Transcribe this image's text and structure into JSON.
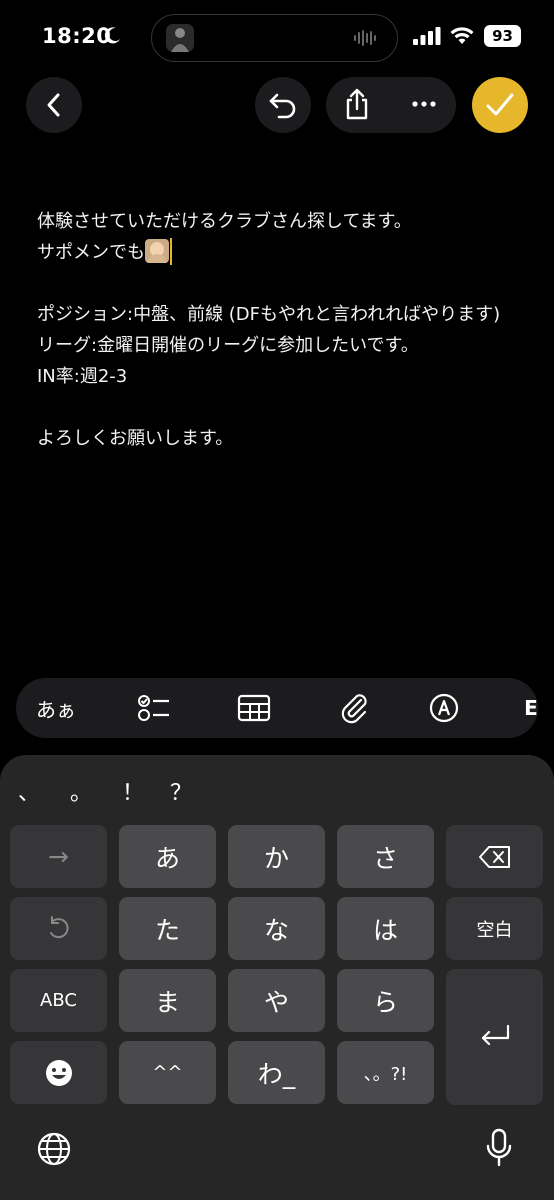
{
  "status": {
    "time": "18:20",
    "battery": "93"
  },
  "note": {
    "lines": [
      "体験させていただけるクラブさん探してます。",
      "サポメンでも",
      "",
      "ポジション:中盤、前線 (DFもやれと言われればやります)",
      "リーグ:金曜日開催のリーグに参加したいです。",
      "IN率:週2-3",
      "",
      "よろしくお願いします。"
    ]
  },
  "format_bar": {
    "text_style": "あぁ",
    "more": "E"
  },
  "keyboard": {
    "punctuation": [
      "、",
      "。",
      "！",
      "？"
    ],
    "rows": [
      [
        "→",
        "あ",
        "か",
        "さ",
        "⌫"
      ],
      [
        "↺",
        "た",
        "な",
        "は",
        "空白"
      ],
      [
        "ABC",
        "ま",
        "や",
        "ら",
        "⏎"
      ],
      [
        "☻",
        "^^",
        "わ_",
        "、。?!"
      ]
    ]
  },
  "colors": {
    "accent": "#e6b72b",
    "background": "#000000",
    "key": "#4a4a4c",
    "key_dark": "#363638"
  }
}
